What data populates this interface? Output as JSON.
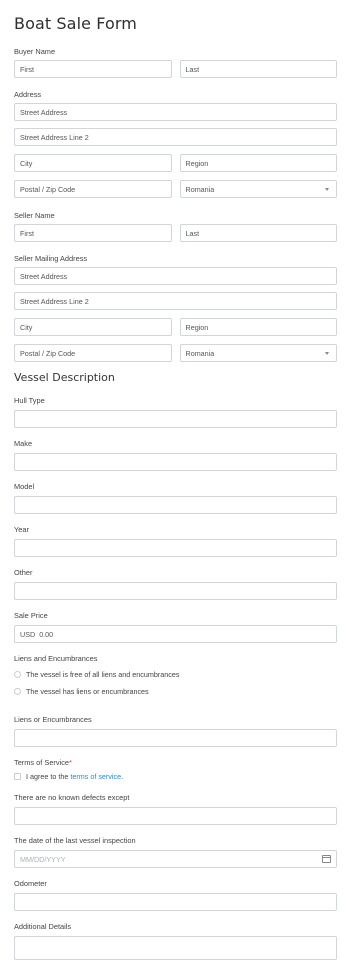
{
  "form": {
    "title": "Boat Sale Form",
    "buyer_name": {
      "label": "Buyer Name",
      "first": "First",
      "last": "Last"
    },
    "address": {
      "label": "Address",
      "street": "Street Address",
      "street2": "Street Address Line 2",
      "city": "City",
      "region": "Region",
      "postal": "Postal / Zip Code",
      "country": "Romania"
    },
    "seller_name": {
      "label": "Seller Name",
      "first": "First",
      "last": "Last"
    },
    "seller_address": {
      "label": "Seller Mailing Address",
      "street": "Street Address",
      "street2": "Street Address Line 2",
      "city": "City",
      "region": "Region",
      "postal": "Postal / Zip Code",
      "country": "Romania"
    },
    "vessel_section": "Vessel Description",
    "hull_type": {
      "label": "Hull Type",
      "value": ""
    },
    "make": {
      "label": "Make",
      "value": ""
    },
    "model": {
      "label": "Model",
      "value": ""
    },
    "year": {
      "label": "Year",
      "value": ""
    },
    "other": {
      "label": "Other",
      "value": ""
    },
    "sale_price": {
      "label": "Sale Price",
      "currency": "USD",
      "value": "0.00"
    },
    "liens": {
      "label": "Liens and Encumbrances",
      "option1": "The vessel is free of all liens and encumbrances",
      "option2": "The vessel has liens or encumbrances"
    },
    "liens_detail": {
      "label": "Liens or Encumbrances",
      "value": ""
    },
    "terms": {
      "label": "Terms of Service",
      "required_mark": "*",
      "agree_prefix": "I agree to the",
      "link": "terms of service",
      "suffix": "."
    },
    "defects": {
      "label": "There are no known defects except",
      "value": ""
    },
    "inspection_date": {
      "label": "The date of the last vessel inspection",
      "placeholder": "MM/DD/YYYY"
    },
    "odometer": {
      "label": "Odometer",
      "value": ""
    },
    "additional": {
      "label": "Additional Details",
      "value": ""
    }
  }
}
